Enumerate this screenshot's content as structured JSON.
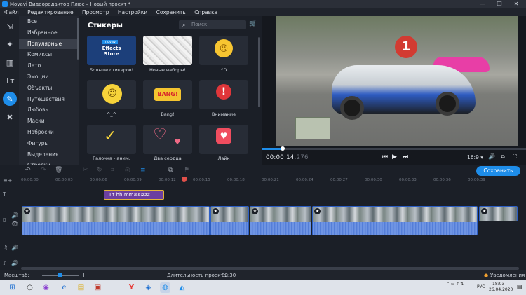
{
  "window": {
    "title": "Movavi Видеоредактор Плюс – Новый проект *",
    "controls": [
      "—",
      "❐",
      "✕"
    ]
  },
  "menu": [
    "Файл",
    "Редактирование",
    "Просмотр",
    "Настройки",
    "Сохранить",
    "Справка"
  ],
  "categories": {
    "items": [
      "Все",
      "Избранное",
      "Популярные",
      "Комиксы",
      "Лето",
      "Эмоции",
      "Объекты",
      "Путешествия",
      "Любовь",
      "Маски",
      "Наброски",
      "Фигуры",
      "Выделения",
      "Стрелки"
    ],
    "selected": "Популярные"
  },
  "stickers": {
    "title": "Стикеры",
    "search_placeholder": "Поиск",
    "store_brand": "movavi",
    "store_title": "Effects Store",
    "tiles": [
      {
        "label": "Больше стикеров!"
      },
      {
        "label": "Новые наборы!"
      },
      {
        "label": ":'D"
      },
      {
        "label": "^_^"
      },
      {
        "label": "Bang!"
      },
      {
        "label": "Внимание"
      },
      {
        "label": "Галочка - аним."
      },
      {
        "label": "Два сердца"
      },
      {
        "label": "Лайк"
      }
    ],
    "bang_text": "BANG!"
  },
  "preview": {
    "badge": "1",
    "time_main": "00:00:14",
    "time_ms": ".276",
    "aspect": "16:9 ▾",
    "progress_fraction": 0.08
  },
  "timeline": {
    "export_label": "Сохранить",
    "ruler": [
      "00:00:00",
      "00:00:03",
      "00:00:06",
      "00:00:09",
      "00:00:12",
      "00:00:15",
      "00:00:18",
      "00:00:21",
      "00:00:24",
      "00:00:27",
      "00:00:30",
      "00:00:33",
      "00:00:36",
      "00:00:39"
    ],
    "title_clip": "hh:mm:ss:zzz"
  },
  "status": {
    "scale_label": "Масштаб:",
    "duration_label": "Длительность проекта:",
    "duration_value": "03:30",
    "notifications": "Уведомления"
  },
  "taskbar": {
    "lang": "РУС",
    "time": "18:03",
    "date": "26.04.2020"
  }
}
